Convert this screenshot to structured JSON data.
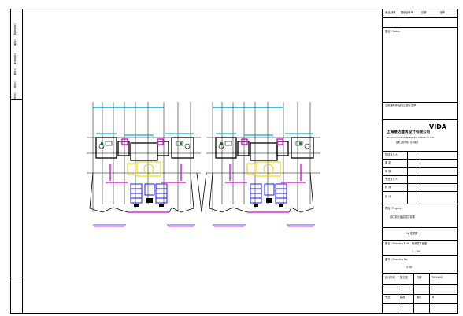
{
  "binding_strip": {
    "items": [
      "项目负责人",
      "审定人",
      "专业负责人",
      "审核人",
      "校对人",
      "设计人"
    ]
  },
  "title_block": {
    "top_row": [
      "专业/版本",
      "图纸版本号",
      "日期",
      "版本"
    ],
    "notes_label": "备注 / Notes",
    "stamp_text": "注册建筑师/结构工程师签章",
    "company": {
      "logo": "VIDA",
      "name_cn": "上海维达建筑设计有限公司",
      "name_en": "SHANGHAI VIDA ARCHITECTURAL DESIGN CO.,LTD",
      "cert": "建筑工程甲级 / 证书编号"
    },
    "sign_rows": [
      "项目负责人",
      "审 定",
      "审 核",
      "专业负责人",
      "校 对",
      "设 计"
    ],
    "project_label": "项目 / Project",
    "project_name": "某住宅小区高层住宅楼",
    "subitem": "1# 住宅楼",
    "drawing_title_label": "图名 / Drawing Title",
    "drawing_title": "标准层平面图",
    "scale": "1 : 100",
    "drawing_no_label": "图号 / Drawing No.",
    "drawing_no": "JS-08",
    "bottom": {
      "phase_label": "设计阶段",
      "phase": "施工图",
      "date_label": "日期",
      "date": "2014.06",
      "sheet_label": "专业",
      "sheet": "建筑",
      "rev_label": "版次",
      "rev": "A"
    }
  },
  "colors": {
    "wall": "#000000",
    "cyan": "#00b4d8",
    "magenta": "#d400d4",
    "yellow": "#e6d200",
    "blue": "#1a1aff",
    "green": "#00a000"
  }
}
